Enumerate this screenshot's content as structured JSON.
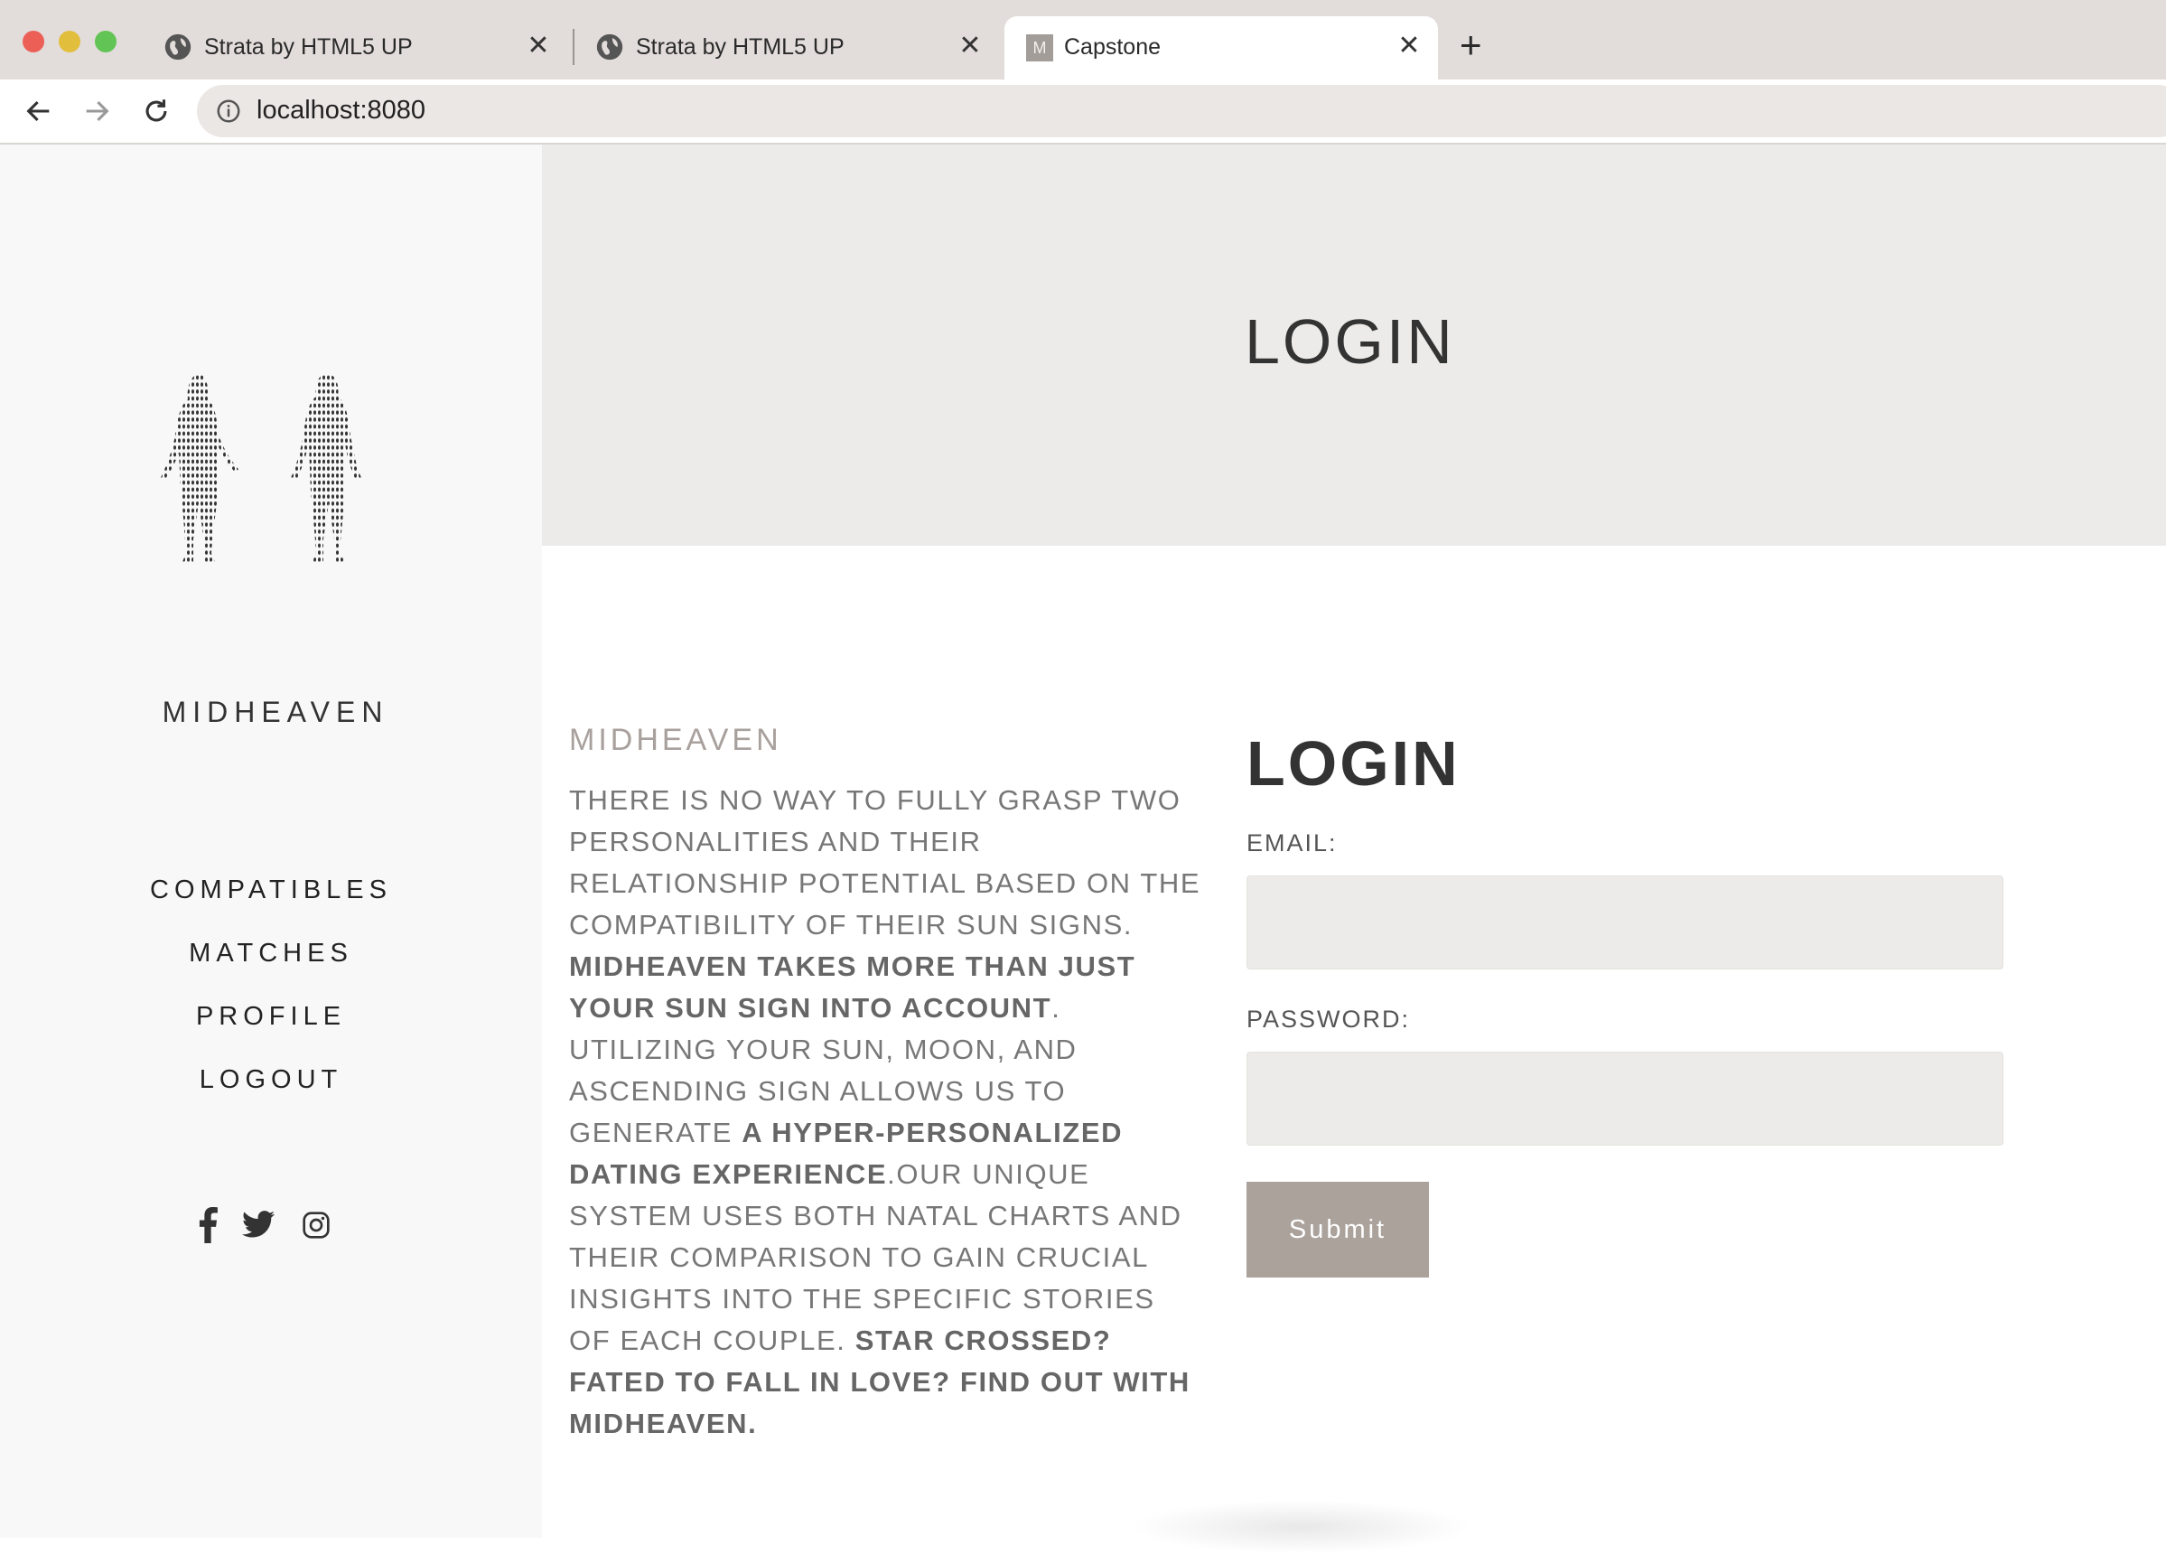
{
  "browser": {
    "tabs": [
      {
        "title": "Strata by HTML5 UP",
        "icon": "globe-icon"
      },
      {
        "title": "Strata by HTML5 UP",
        "icon": "globe-icon"
      },
      {
        "title": "Capstone",
        "icon": "m-favicon",
        "favicon_letter": "M",
        "active": true
      }
    ],
    "close_glyph": "✕",
    "new_tab_glyph": "+",
    "url": "localhost:8080"
  },
  "sidebar": {
    "logo_text": "MIDHEAVEN",
    "nav": [
      {
        "label": "COMPATIBLES"
      },
      {
        "label": "MATCHES"
      },
      {
        "label": "PROFILE"
      },
      {
        "label": "LOGOUT"
      }
    ],
    "social": [
      "facebook-icon",
      "twitter-icon",
      "instagram-icon"
    ]
  },
  "hero": {
    "title": "LOGIN"
  },
  "about": {
    "heading": "MIDHEAVEN",
    "p1": "THERE IS NO WAY TO FULLY GRASP TWO PERSONALITIES AND THEIR RELATIONSHIP POTENTIAL BASED ON THE COMPATIBILITY OF THEIR SUN SIGNS. ",
    "b1": "MIDHEAVEN TAKES MORE THAN JUST YOUR SUN SIGN INTO ACCOUNT",
    "p2": ". UTILIZING YOUR SUN, MOON, AND ASCENDING SIGN ALLOWS US TO GENERATE ",
    "b2": "A HYPER-PERSONALIZED DATING EXPERIENCE",
    "p3": ".OUR UNIQUE SYSTEM USES BOTH NATAL CHARTS AND THEIR COMPARISON TO GAIN CRUCIAL INSIGHTS INTO THE SPECIFIC STORIES OF EACH COUPLE. ",
    "b3": "STAR CROSSED? FATED TO FALL IN LOVE? FIND OUT WITH MIDHEAVEN."
  },
  "login": {
    "title": "LOGIN",
    "email_label": "EMAIL:",
    "password_label": "PASSWORD:",
    "submit_label": "Submit"
  },
  "colors": {
    "sidebar_bg": "#f8f8f8",
    "hero_bg": "#ecebe9",
    "button_bg": "#aba29c",
    "heading_accent": "#a8a09c"
  }
}
